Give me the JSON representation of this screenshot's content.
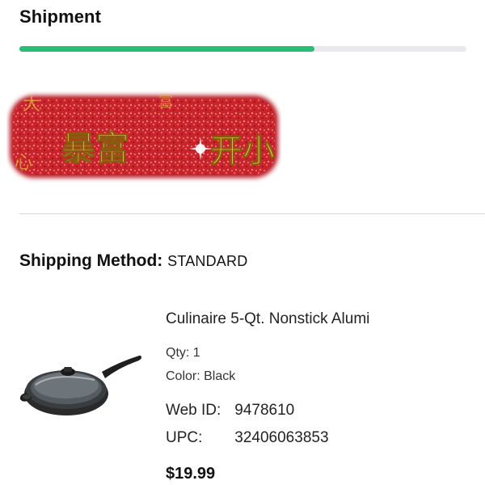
{
  "shipment": {
    "title": "Shipment",
    "progress_percent": 66,
    "progress_color": "#2dbb76"
  },
  "banner": {
    "chars_left": "暴富",
    "chars_right": "开小"
  },
  "shipping": {
    "method_label": "Shipping Method:",
    "method_value": "STANDARD"
  },
  "product": {
    "icon": "frying-pan-icon",
    "name": "Culinaire 5-Qt. Nonstick Alumi",
    "qty": "Qty: 1",
    "color": "Color: Black",
    "web_id_label": "Web ID:",
    "web_id_value": "9478610",
    "upc_label": "UPC:",
    "upc_value": "32406063853",
    "price": "$19.99"
  }
}
